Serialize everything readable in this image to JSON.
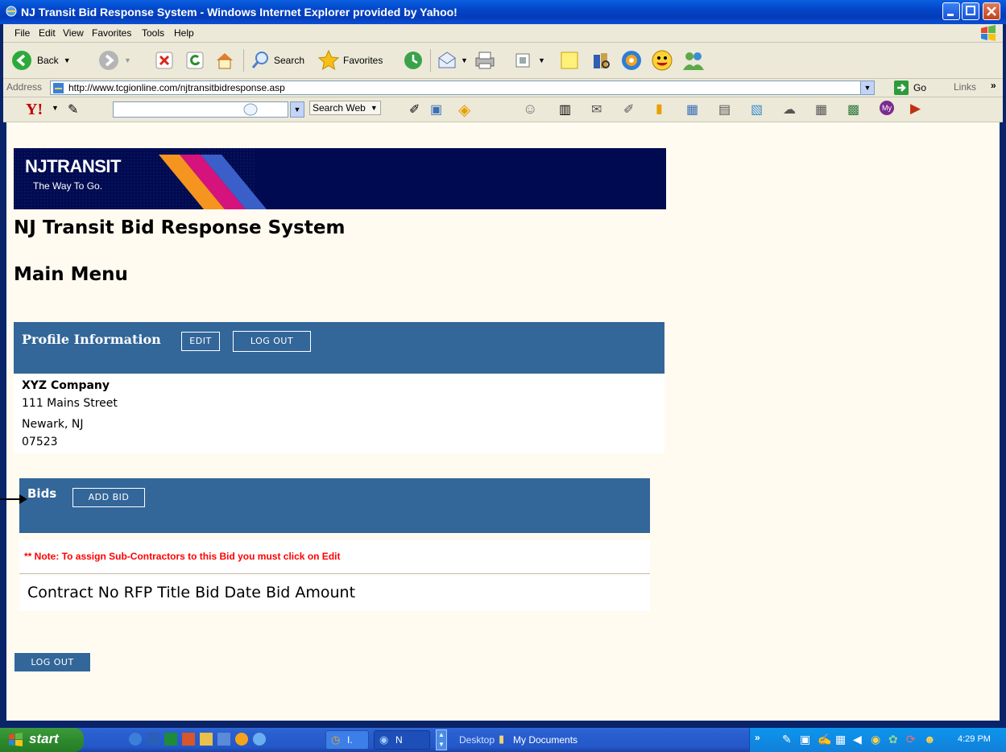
{
  "window": {
    "title": "NJ Transit Bid Response System - Windows Internet Explorer provided by Yahoo!"
  },
  "menu": [
    "File",
    "Edit",
    "View",
    "Favorites",
    "Tools",
    "Help"
  ],
  "toolbar": {
    "back_label": "Back",
    "search_label": "Search",
    "favorites_label": "Favorites"
  },
  "address_bar": {
    "label": "Address",
    "url": "http://www.tcgionline.com/njtransitbidresponse.asp",
    "go_label": "Go",
    "links_label": "Links"
  },
  "yahoo_toolbar": {
    "search_web_label": "Search Web",
    "search_value": ""
  },
  "page": {
    "logo": {
      "brand": "NJTRANSIT",
      "tagline": "The Way To Go."
    },
    "title": "NJ Transit Bid Response System",
    "subtitle": "Main Menu",
    "profile": {
      "heading": "Profile Information",
      "edit_label": "Edit",
      "logout_label": "Log Out",
      "company": "XYZ Company",
      "street": "111 Mains Street",
      "city": "Newark, NJ",
      "zip": "07523"
    },
    "bids": {
      "heading": "Bids",
      "add_label": "Add Bid",
      "note": "** Note: To assign Sub-Contractors to this Bid you must click on Edit",
      "columns": [
        "Contract No",
        "RFP Title",
        "Bid Date",
        "Bid Amount"
      ]
    },
    "bottom_logout_label": "Log Out"
  },
  "taskbar": {
    "start_label": "start",
    "tasks": [
      {
        "label": "I."
      },
      {
        "label": "N"
      }
    ],
    "desktop_label": "Desktop",
    "my_documents_label": "My Documents",
    "clock": "4:29 PM"
  },
  "colors": {
    "panel": "#336699",
    "note": "#ff0000",
    "content_bg": "#fffbf0"
  }
}
